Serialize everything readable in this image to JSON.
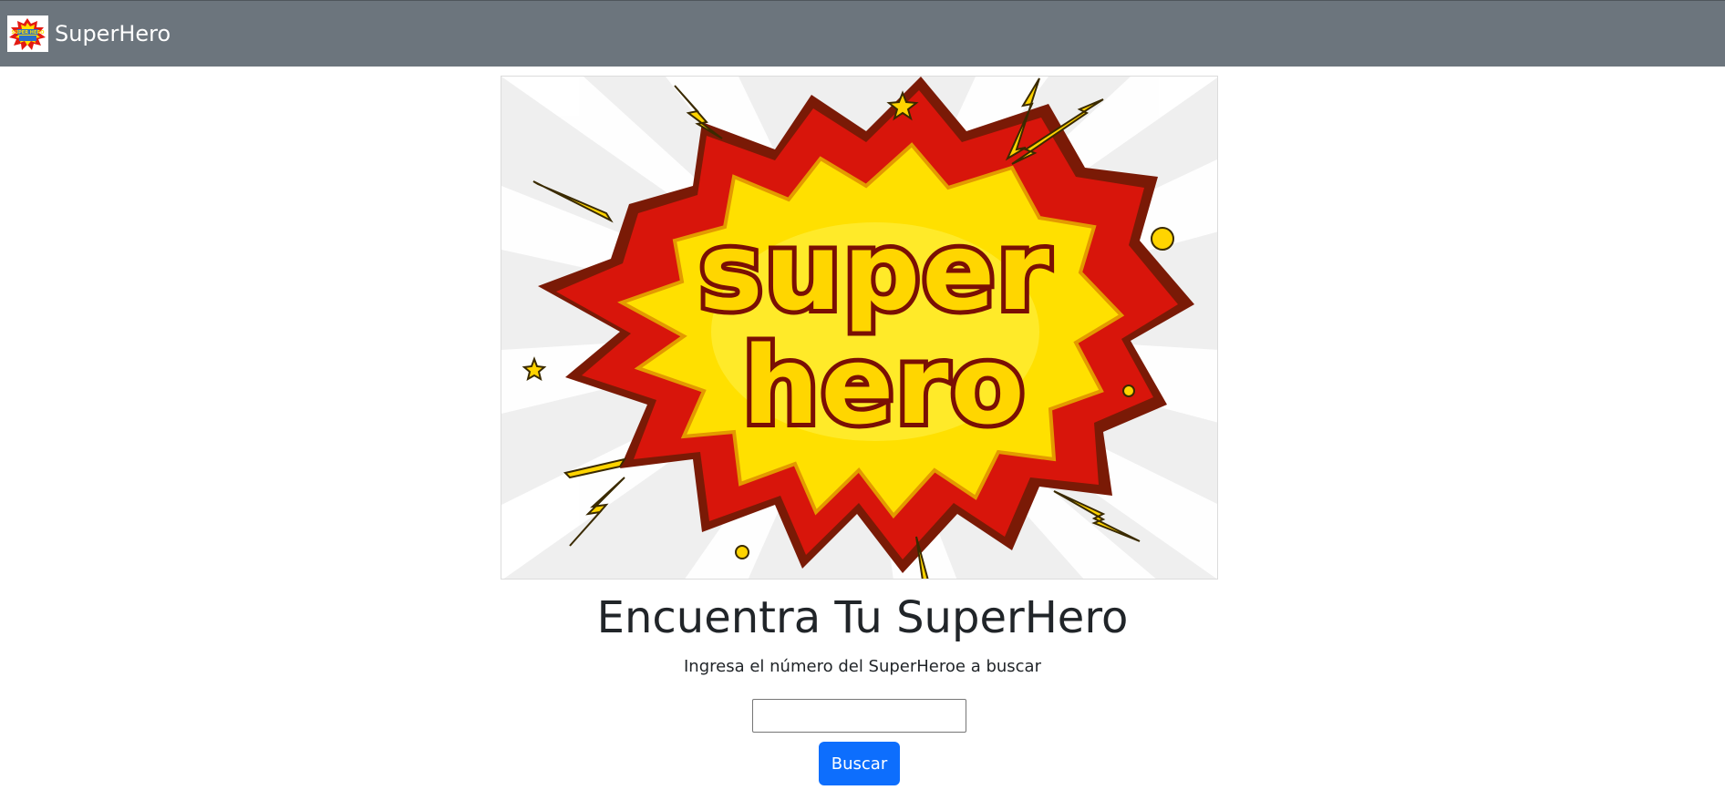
{
  "navbar": {
    "brand_text": "SuperHero",
    "logo_text": "SUPER HERO",
    "background": "#6c757d"
  },
  "hero": {
    "image_text_line1": "super",
    "image_text_line2": "hero",
    "colors": {
      "burst_red": "#d8150b",
      "burst_yellow": "#ffe000",
      "text_yellow": "#ffd600"
    }
  },
  "main": {
    "title": "Encuentra Tu SuperHero",
    "subtitle": "Ingresa el número del SuperHeroe a buscar",
    "search_value": "",
    "search_placeholder": "",
    "button_label": "Buscar",
    "button_color": "#0d6efd"
  }
}
